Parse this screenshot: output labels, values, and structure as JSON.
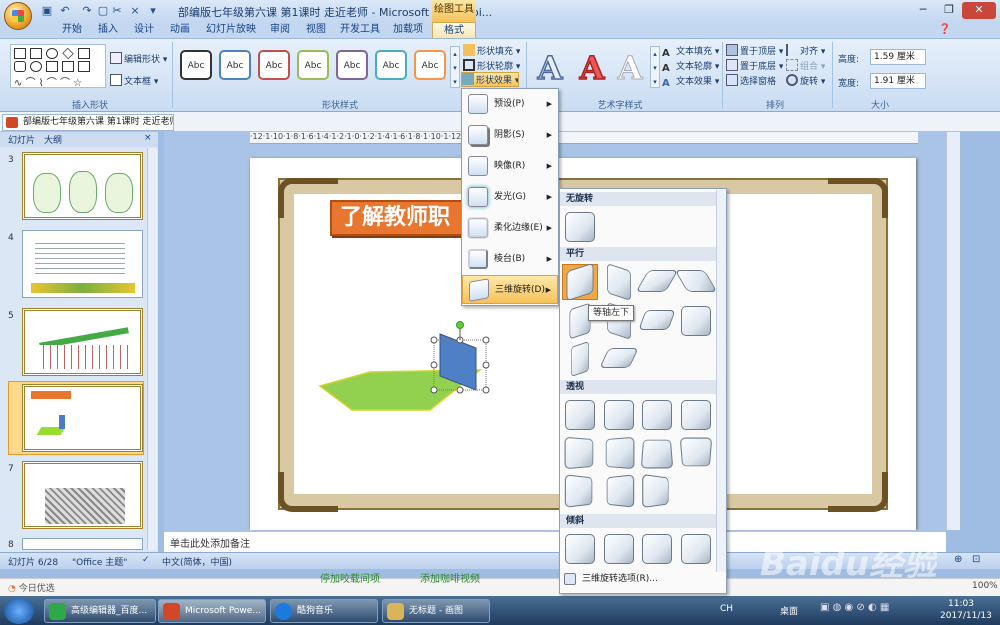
{
  "window": {
    "title": "部编版七年级第六课 第1课时 走近老师 - Microsoft PowerPoi...",
    "context_tab_group": "绘图工具"
  },
  "tabs": [
    "开始",
    "插入",
    "设计",
    "动画",
    "幻灯片放映",
    "审阅",
    "视图",
    "开发工具",
    "加载项",
    "格式"
  ],
  "ribbon": {
    "insert_shapes": {
      "edit_shape": "编辑形状",
      "text_box": "文本框",
      "label": "插入形状"
    },
    "shape_styles": {
      "sample": "Abc",
      "fill": "形状填充",
      "outline": "形状轮廓",
      "effects": "形状效果",
      "label": "形状样式"
    },
    "wordart": {
      "letter": "A",
      "text_fill": "文本填充",
      "text_outline": "文本轮廓",
      "text_effects": "文本效果",
      "label": "艺术字样式"
    },
    "arrange": {
      "bring_front": "置于顶层",
      "send_back": "置于底层",
      "selection_pane": "选择窗格",
      "align": "对齐",
      "group": "组合",
      "rotate": "旋转",
      "label": "排列"
    },
    "size": {
      "height_label": "高度:",
      "height_value": "1.59 厘米",
      "width_label": "宽度:",
      "width_value": "1.91 厘米",
      "label": "大小"
    }
  },
  "doc_tab": "部编版七年级第六课 第1课时 走近老师",
  "panel_tabs": {
    "slides": "幻灯片",
    "outline": "大纲"
  },
  "slide_numbers": [
    "3",
    "4",
    "5",
    "6",
    "7",
    "8"
  ],
  "ruler_text": "·12·1·10·1·8·1·6·1·4·1·2·1·0·1·2·1·4·1·6·1·8·1·10·1·12",
  "slide_title": "了解教师职",
  "notes_placeholder": "单击此处添加备注",
  "status": {
    "slide": "幻灯片 6/28",
    "theme": "\"Office 主题\"",
    "lang": "中文(简体，中国)"
  },
  "browser": {
    "left": "今日优选",
    "mid1": "停加咬载间项",
    "mid2": "添加咖啡视频",
    "zoom": "100%"
  },
  "effects_menu": [
    {
      "label": "预设(P)"
    },
    {
      "label": "阴影(S)"
    },
    {
      "label": "映像(R)"
    },
    {
      "label": "发光(G)"
    },
    {
      "label": "柔化边缘(E)"
    },
    {
      "label": "棱台(B)"
    },
    {
      "label": "三维旋转(D)"
    }
  ],
  "rotation_gallery": {
    "sections": [
      "无旋转",
      "平行",
      "透视",
      "倾斜"
    ],
    "tooltip": "等轴左下",
    "options_link": "三维旋转选项(R)..."
  },
  "taskbar": {
    "items": [
      "高级编辑器_百度...",
      "Microsoft Powe...",
      "酷狗音乐",
      "无标题 - 画图"
    ],
    "tray": {
      "lang": "CH",
      "desktop": "桌面",
      "time": "11:03",
      "date": "2017/11/13"
    }
  },
  "watermark": "Baidu经验"
}
